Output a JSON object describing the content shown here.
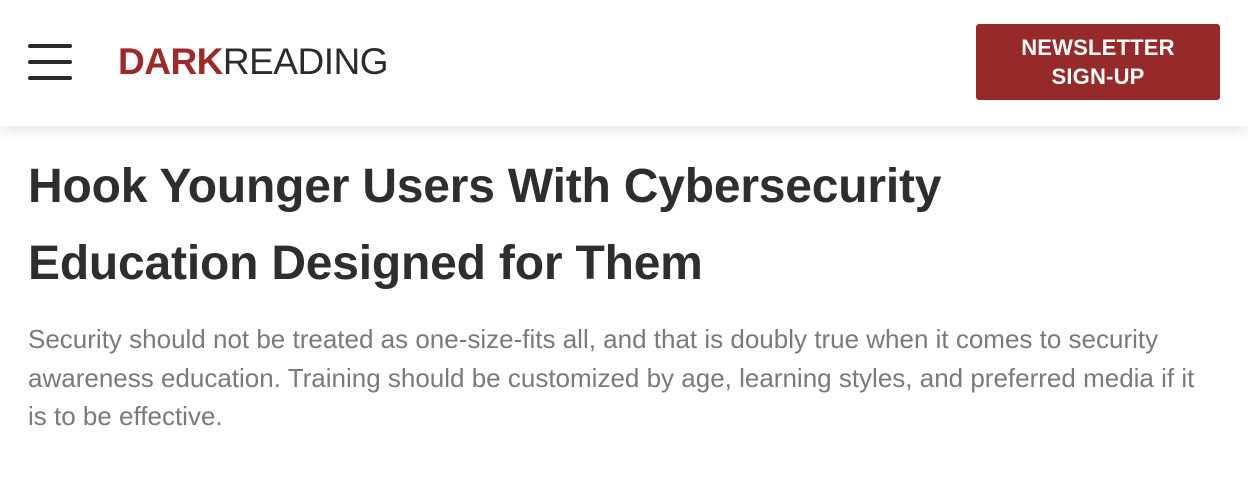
{
  "header": {
    "logo_primary": "DARK",
    "logo_secondary": "READING",
    "newsletter_line1": "NEWSLETTER",
    "newsletter_line2": "SIGN-UP"
  },
  "article": {
    "headline": "Hook Younger Users With Cybersecurity Education Designed for Them",
    "summary": "Security should not be treated as one-size-fits all, and that is doubly true when it comes to security awareness education. Training should be customized by age, learning styles, and preferred media if it is to be effective."
  },
  "icons": {
    "menu": "hamburger-menu-icon"
  },
  "colors": {
    "brand": "#9b2a2a",
    "button": "#962a2a",
    "headline": "#2e2e2e",
    "summary": "#7a7a7a"
  }
}
